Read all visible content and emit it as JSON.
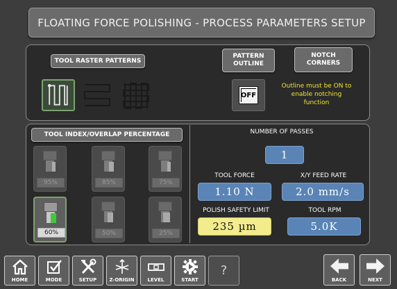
{
  "title": "FLOATING FORCE POLISHING - PROCESS PARAMETERS SETUP",
  "raster": {
    "label": "TOOL RASTER PATTERNS",
    "patterns": [
      {
        "icon": "vertical-raster-icon",
        "selected": true
      },
      {
        "icon": "horizontal-raster-icon",
        "selected": false
      },
      {
        "icon": "grid-raster-icon",
        "selected": false
      }
    ]
  },
  "outline": {
    "label": "PATTERN OUTLINE",
    "toggle": "OFF"
  },
  "notch": {
    "label": "NOTCH CORNERS",
    "note": "Outline must be ON to enable notching function"
  },
  "overlap": {
    "label": "TOOL INDEX/OVERLAP PERCENTAGE",
    "options": [
      {
        "pct": "95%",
        "selected": false
      },
      {
        "pct": "85%",
        "selected": false
      },
      {
        "pct": "75%",
        "selected": false
      },
      {
        "pct": "60%",
        "selected": true
      },
      {
        "pct": "50%",
        "selected": false
      },
      {
        "pct": "25%",
        "selected": false
      }
    ]
  },
  "passes": {
    "label": "NUMBER OF PASSES",
    "value": "1"
  },
  "tool_force": {
    "label": "TOOL FORCE",
    "value": "1.10 N"
  },
  "feed_rate": {
    "label": "X/Y FEED RATE",
    "value": "2.0 mm/s"
  },
  "safety_limit": {
    "label": "POLISH SAFETY LIMIT",
    "value": "235 µm"
  },
  "rpm": {
    "label": "TOOL RPM",
    "value": "5.0K"
  },
  "nav": {
    "home": "HOME",
    "mode": "MODE",
    "setup": "SETUP",
    "zorigin": "Z-ORIGIN",
    "level": "LEVEL",
    "start": "START",
    "help": "?",
    "back": "BACK",
    "next": "NEXT"
  },
  "colors": {
    "value_blue": "#5a84b6",
    "value_yellow": "#f2ec8c",
    "selected_green": "#7ca36f",
    "note_yellow": "#f2e32a"
  }
}
